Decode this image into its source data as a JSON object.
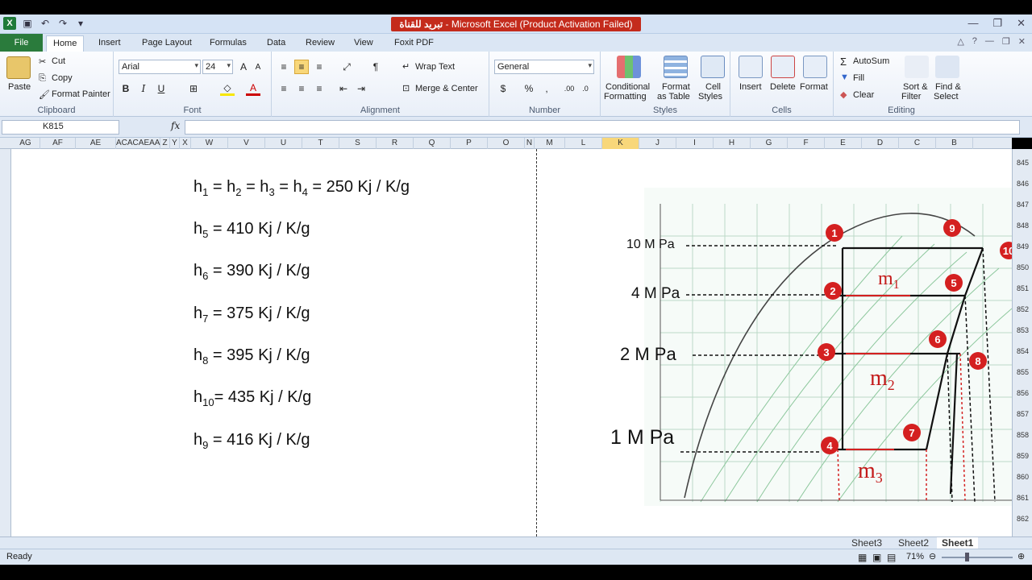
{
  "window": {
    "title_arabic": "تبريد للقناة",
    "title": " - Microsoft Excel (Product Activation Failed)"
  },
  "ribbon_tabs": [
    "File",
    "Home",
    "Insert",
    "Page Layout",
    "Formulas",
    "Data",
    "Review",
    "View",
    "Foxit PDF"
  ],
  "clipboard": {
    "paste": "Paste",
    "cut": "Cut",
    "copy": "Copy",
    "format_painter": "Format Painter",
    "label": "Clipboard"
  },
  "font": {
    "name": "Arial",
    "size": "24",
    "bold": "B",
    "italic": "I",
    "underline": "U",
    "label": "Font"
  },
  "alignment": {
    "wrap": "Wrap Text",
    "merge": "Merge & Center",
    "label": "Alignment"
  },
  "number": {
    "format": "General",
    "currency": "$",
    "percent": "%",
    "comma": ",",
    "label": "Number"
  },
  "styles": {
    "conditional": "Conditional",
    "conditional2": "Formatting",
    "format_table": "Format",
    "format_table2": "as Table",
    "cell_styles": "Cell",
    "cell_styles2": "Styles",
    "label": "Styles"
  },
  "cells": {
    "insert": "Insert",
    "delete": "Delete",
    "format": "Format",
    "label": "Cells"
  },
  "editing": {
    "autosum": "AutoSum",
    "fill": "Fill",
    "clear": "Clear",
    "sort": "Sort &",
    "sort2": "Filter",
    "find": "Find &",
    "find2": "Select",
    "label": "Editing"
  },
  "formula_bar": {
    "name_box": "K815",
    "fx": "fx",
    "value": ""
  },
  "columns": [
    "AG",
    "AF",
    "AE",
    "ACACAEAA",
    "Z",
    "Y",
    "X",
    "W",
    "V",
    "U",
    "T",
    "S",
    "R",
    "Q",
    "P",
    "O",
    "N",
    "M",
    "L",
    "K",
    "J",
    "I",
    "H",
    "G",
    "F",
    "E",
    "D",
    "C",
    "B"
  ],
  "rows": [
    "845",
    "846",
    "847",
    "848",
    "849",
    "850",
    "851",
    "852",
    "853",
    "854",
    "855",
    "856",
    "857",
    "858",
    "859",
    "860",
    "861",
    "862"
  ],
  "equations": [
    {
      "lhs": "h",
      "sub": "1",
      "rest": " = h",
      "sub2": "2",
      "rest2": " = h",
      "sub3": "3",
      "rest3": " = h",
      "sub4": "4",
      "rest4": " = 250 Kj / K/g"
    },
    {
      "lhs": "h",
      "sub": "5",
      "rest": " =  410 Kj / K/g"
    },
    {
      "lhs": "h",
      "sub": "6",
      "rest": " =  390 Kj / K/g"
    },
    {
      "lhs": "h",
      "sub": "7",
      "rest": " =  375 Kj / K/g"
    },
    {
      "lhs": "h",
      "sub": "8",
      "rest": " =  395 Kj / K/g"
    },
    {
      "lhs": "h",
      "sub": "10",
      "rest": "=  435 Kj / K/g"
    },
    {
      "lhs": "h",
      "sub": "9",
      "rest": " =  416 Kj / K/g"
    }
  ],
  "diagram": {
    "pressures": [
      "10 M Pa",
      "4 M Pa",
      "2 M Pa",
      "1 M Pa"
    ],
    "points": [
      "1",
      "2",
      "3",
      "4",
      "5",
      "6",
      "7",
      "8",
      "9",
      "10"
    ],
    "masses": {
      "m1": "m",
      "m1sub": "1",
      "m2": "m",
      "m2sub": "2",
      "m3": "m",
      "m3sub": "3"
    }
  },
  "sheets": [
    "Sheet3",
    "Sheet2",
    "Sheet1"
  ],
  "status": {
    "ready": "Ready",
    "zoom": "71%"
  },
  "colors": {
    "accent_green": "#2a7b3c",
    "title_red": "#c42b1c",
    "marker_red": "#d42020"
  }
}
